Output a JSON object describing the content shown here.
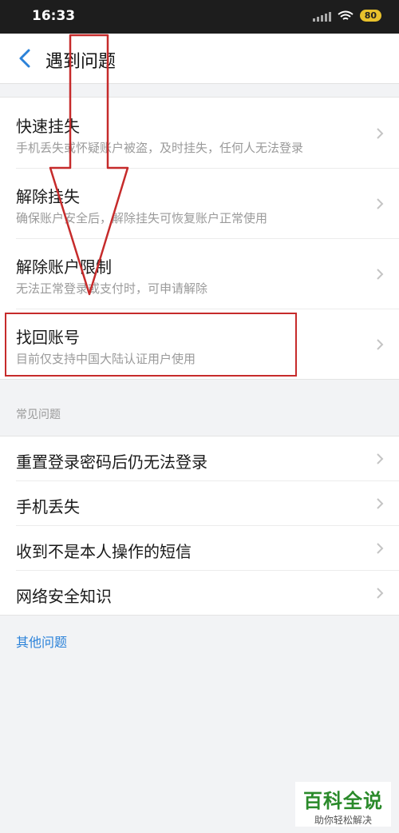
{
  "status": {
    "time": "16:33",
    "battery": "80"
  },
  "nav": {
    "title": "遇到问题"
  },
  "items": [
    {
      "title": "快速挂失",
      "subtitle": "手机丢失或怀疑账户被盗，及时挂失，任何人无法登录"
    },
    {
      "title": "解除挂失",
      "subtitle": "确保账户安全后，解除挂失可恢复账户正常使用"
    },
    {
      "title": "解除账户限制",
      "subtitle": "无法正常登录或支付时，可申请解除"
    },
    {
      "title": "找回账号",
      "subtitle": "目前仅支持中国大陆认证用户使用"
    }
  ],
  "faq": {
    "label": "常见问题",
    "items": [
      "重置登录密码后仍无法登录",
      "手机丢失",
      "收到不是本人操作的短信",
      "网络安全知识"
    ]
  },
  "other_link": "其他问题",
  "watermark": {
    "main": "百科全说",
    "sub": "助你轻松解决"
  },
  "colors": {
    "accent": "#2b82d9",
    "annotation": "#c62b2b",
    "status_bar": "#1d1d1d",
    "watermark": "#2a8a2a"
  }
}
